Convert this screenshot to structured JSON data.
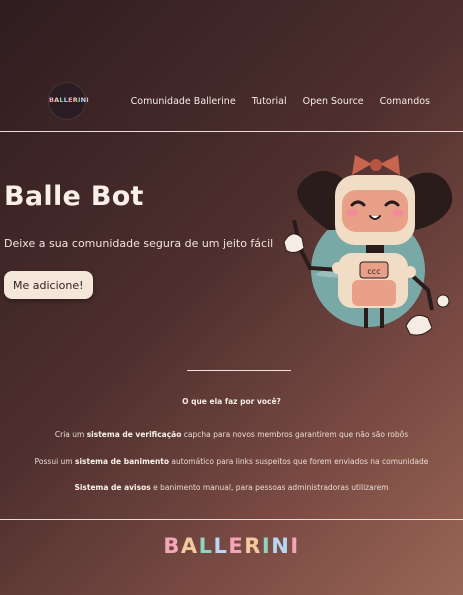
{
  "header": {
    "logo_text": "BALLERINI",
    "nav": [
      "Comunidade Ballerine",
      "Tutorial",
      "Open Source",
      "Comandos"
    ]
  },
  "hero": {
    "title": "Balle Bot",
    "subtitle": "Deixe a sua comunidade segura de um jeito fácil",
    "cta_label": "Me adicione!"
  },
  "features": {
    "title": "O que ela faz por você?",
    "items": [
      {
        "pre": "Cria um ",
        "strong": "sistema de verificação",
        "post": " capcha para novos membros garantirem que não são robôs"
      },
      {
        "pre": "Possui um ",
        "strong": "sistema de banimento",
        "post": " automático para links suspeitos que forem enviados na comunidade"
      },
      {
        "pre": "",
        "strong": "Sistema de avisos",
        "post": " e banimento manual, para pessoas administradoras utilizarem"
      }
    ]
  },
  "footer": {
    "wordmark_letters": [
      "B",
      "A",
      "L",
      "L",
      "E",
      "R",
      "I",
      "N",
      "I"
    ],
    "wordmark_colors": [
      "#f4a6b8",
      "#f3c9a1",
      "#8fd3c3",
      "#b8d7f2",
      "#f4a6b8",
      "#f3c9a1",
      "#8fd3c3",
      "#b8d7f2",
      "#f4a6b8"
    ]
  },
  "colors": {
    "accent_button": "#f5e6da",
    "robot_bow": "#c8654f",
    "robot_face": "#e8a088",
    "robot_body": "#f1dcc6"
  },
  "icons": [
    "ballerini-logo-icon",
    "balle-bot-robot-illustration"
  ]
}
